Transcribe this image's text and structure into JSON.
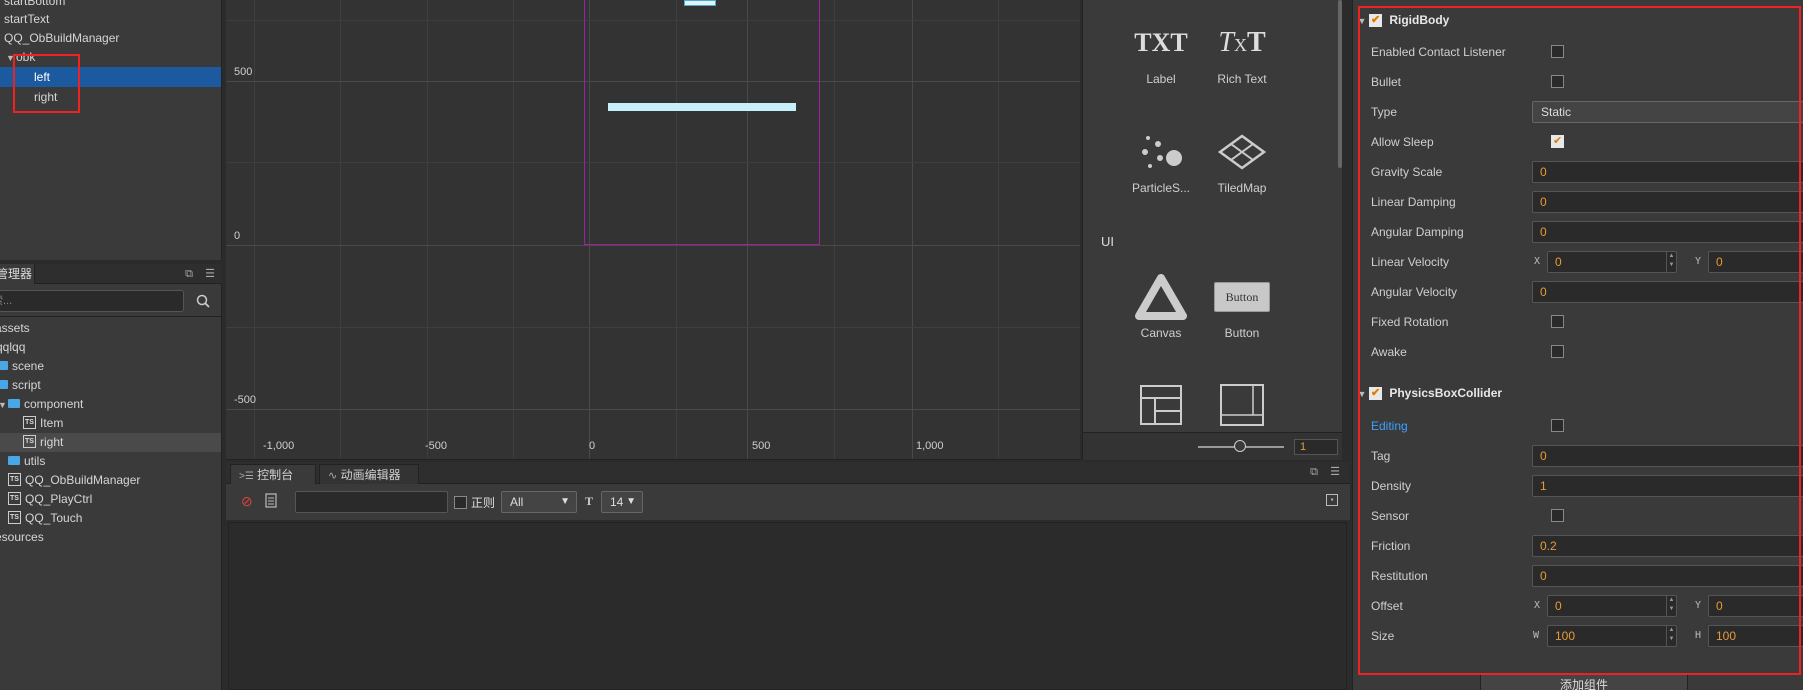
{
  "hierarchy": {
    "items": [
      {
        "label": "startBottom"
      },
      {
        "label": "startText"
      },
      {
        "label": "QQ_ObBuildManager"
      },
      {
        "label": "obk"
      },
      {
        "label": "left"
      },
      {
        "label": "right"
      }
    ]
  },
  "assets": {
    "tab_label": "资源管理器",
    "search_placeholder": "搜索...",
    "items": [
      {
        "label": "assets"
      },
      {
        "label": "qqlqq"
      },
      {
        "label": "scene"
      },
      {
        "label": "script"
      },
      {
        "label": "component"
      },
      {
        "label": "Item"
      },
      {
        "label": "right"
      },
      {
        "label": "utils"
      },
      {
        "label": "QQ_ObBuildManager"
      },
      {
        "label": "QQ_PlayCtrl"
      },
      {
        "label": "QQ_Touch"
      },
      {
        "label": "resources"
      }
    ]
  },
  "scene": {
    "y_labels": [
      "500",
      "0",
      "-500"
    ],
    "x_labels": [
      "-1,000",
      "-500",
      "0",
      "500",
      "1,000"
    ]
  },
  "library": {
    "items": [
      {
        "label": "Label"
      },
      {
        "label": "Rich Text"
      },
      {
        "label": "ParticleS..."
      },
      {
        "label": "TiledMap"
      },
      {
        "label": "Canvas"
      },
      {
        "label": "Button"
      }
    ],
    "section_ui": "UI",
    "icon_txt": "TXT",
    "icon_button_text": "Button",
    "zoom_value": "1"
  },
  "console": {
    "tab_console": "控制台",
    "tab_animation": "动画编辑器",
    "regex_label": "正则",
    "level_select": "All",
    "font_size_select": "14"
  },
  "inspector": {
    "rigidbody_title": "RigidBody",
    "rigidbody_props": {
      "enabled_contact_listener": "Enabled Contact Listener",
      "bullet": "Bullet",
      "type": "Type",
      "type_value": "Static",
      "allow_sleep": "Allow Sleep",
      "gravity_scale": "Gravity Scale",
      "gravity_scale_value": "0",
      "linear_damping": "Linear Damping",
      "linear_damping_value": "0",
      "angular_damping": "Angular Damping",
      "angular_damping_value": "0",
      "linear_velocity": "Linear Velocity",
      "linear_velocity_x": "0",
      "linear_velocity_y": "0",
      "angular_velocity": "Angular Velocity",
      "angular_velocity_value": "0",
      "fixed_rotation": "Fixed Rotation",
      "awake": "Awake"
    },
    "collider_title": "PhysicsBoxCollider",
    "collider_props": {
      "editing": "Editing",
      "tag": "Tag",
      "tag_value": "0",
      "density": "Density",
      "density_value": "1",
      "sensor": "Sensor",
      "friction": "Friction",
      "friction_value": "0.2",
      "restitution": "Restitution",
      "restitution_value": "0",
      "offset": "Offset",
      "offset_x": "0",
      "offset_y": "0",
      "size": "Size",
      "size_w": "100",
      "size_h": "100"
    },
    "axis": {
      "x": "X",
      "y": "Y",
      "w": "W",
      "h": "H"
    },
    "add_component": "添加组件"
  }
}
